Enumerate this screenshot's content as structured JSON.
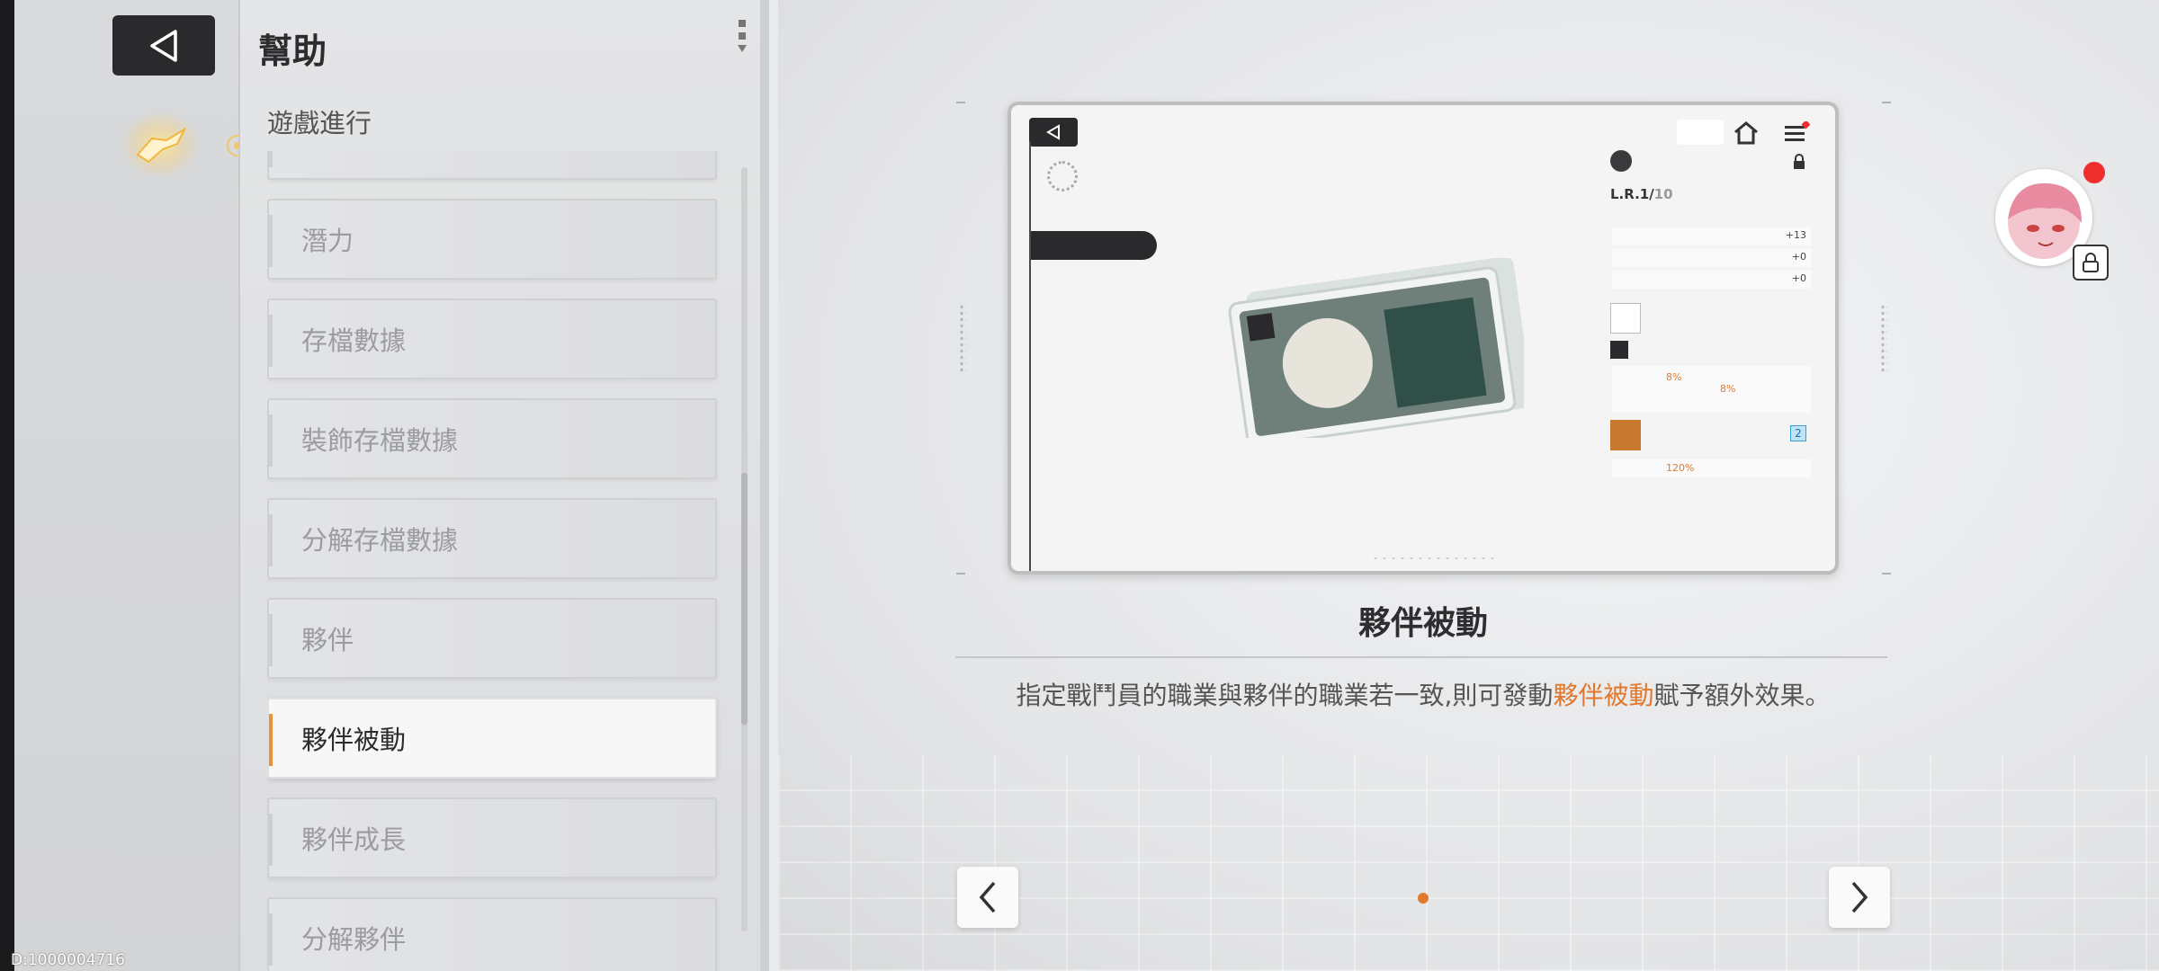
{
  "header": {
    "title": "幫助",
    "category": "遊戲進行"
  },
  "menu": {
    "items": [
      {
        "label": ""
      },
      {
        "label": "潛力"
      },
      {
        "label": "存檔數據"
      },
      {
        "label": "裝飾存檔數據"
      },
      {
        "label": "分解存檔數據"
      },
      {
        "label": "夥伴"
      },
      {
        "label": "夥伴被動",
        "active": true
      },
      {
        "label": "夥伴成長"
      },
      {
        "label": "分解夥伴"
      }
    ]
  },
  "content": {
    "title": "夥伴被動",
    "description_before": "指定戰鬥員的職業與夥伴的職業若一致,則可發動",
    "description_highlight": "夥伴被動",
    "description_after": "賦予額外效果。"
  },
  "preview": {
    "rows": [
      {
        "label": "",
        "value": "+13"
      },
      {
        "label": "",
        "value": "+0"
      },
      {
        "label": "",
        "value": "+0"
      }
    ],
    "level": "L.R.1/",
    "level_max": "10",
    "count": "2",
    "percent_8a": "8%",
    "percent_8b": "8%",
    "percent_120": "120%"
  },
  "pagination": {
    "current_page": 1,
    "total_pages": 1
  },
  "footer": {
    "build_id": "D:1000004716"
  },
  "colors": {
    "accent": "#e2782c",
    "dark": "#2a2a2c",
    "notification": "#ee2d2d"
  },
  "icons": {
    "back": "back-arrow-icon",
    "prev": "chevron-left-icon",
    "next": "chevron-right-icon",
    "kebab": "kebab-icon",
    "lock": "lock-icon"
  }
}
